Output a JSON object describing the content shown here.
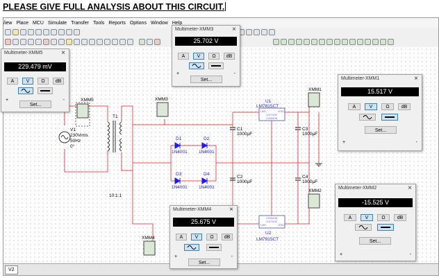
{
  "heading": "PLEASE GIVE FULL ANALYSIS ABOUT THIS CIRCUIT.",
  "menu": [
    "/iew",
    "Place",
    "MCU",
    "Simulate",
    "Transfer",
    "Tools",
    "Reports",
    "Options",
    "Window",
    "Help"
  ],
  "toolbar": {
    "in_use_label": "--- In-Use List ---"
  },
  "components": {
    "v1": {
      "name": "V1",
      "v": "230Vrms",
      "f": "50Hz",
      "p": "0°"
    },
    "t1": {
      "name": "T1",
      "ratio": "10:1:1"
    },
    "d1": {
      "name": "D1",
      "part": "1N4001"
    },
    "d2": {
      "name": "D2",
      "part": "1N4001"
    },
    "d3": {
      "name": "D3",
      "part": "1N4001"
    },
    "d4": {
      "name": "D4",
      "part": "1N4001"
    },
    "c1": {
      "name": "C1",
      "val": "1000µF"
    },
    "c2": {
      "name": "C2",
      "val": "1000µF"
    },
    "c3": {
      "name": "C3",
      "val": "1000µF"
    },
    "c4": {
      "name": "C4",
      "val": "1000µF"
    },
    "u1": {
      "name": "U1",
      "part": "LM7815CT",
      "in": "LINE",
      "out": "VREG",
      "vr": "VOLTAGE",
      "com": "COMMON"
    },
    "u2": {
      "name": "U2",
      "part": "LM7915CT",
      "in": "LINE",
      "out": "VREG",
      "vr": "VOLTAGE",
      "com": "COMMON"
    },
    "xmm1": "XMM1",
    "xmm2": "XMM2",
    "xmm3": "XMM3",
    "xmm4": "XMM4",
    "xmm5": "XMM5"
  },
  "meters": {
    "xmm5": {
      "title": "Multimeter-XMM5",
      "reading": "229.479 mV"
    },
    "xmm3": {
      "title": "Multimeter-XMM3",
      "reading": "25.702 V"
    },
    "xmm1": {
      "title": "Multimeter-XMM1",
      "reading": "15.517 V"
    },
    "xmm2": {
      "title": "Multimeter-XMM2",
      "reading": "-15.525 V"
    },
    "xmm4": {
      "title": "Multimeter-XMM4",
      "reading": "25.675 V"
    }
  },
  "meter_labels": {
    "a": "A",
    "v": "V",
    "ohm": "Ω",
    "db": "dB",
    "set": "Set...",
    "plus": "+",
    "minus": "-"
  },
  "status": {
    "tab": "V2"
  },
  "colors": {
    "wire": "#e05050",
    "ground": "#333333",
    "diode": "#1a1aff"
  }
}
